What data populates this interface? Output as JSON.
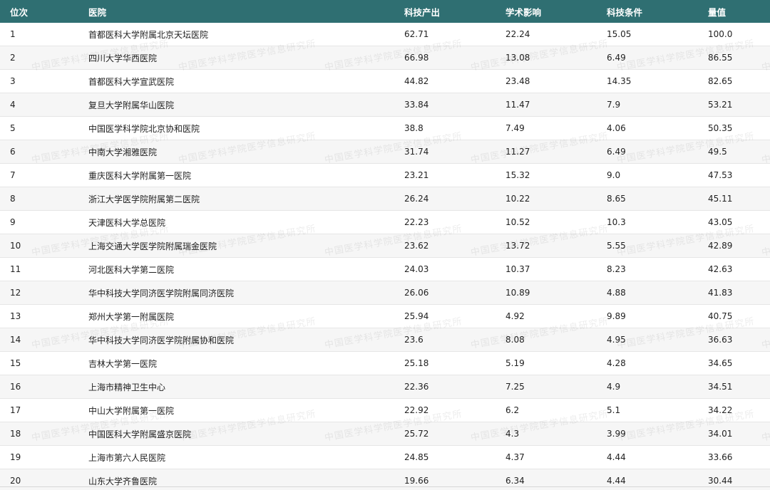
{
  "table": {
    "headers": {
      "rank": "位次",
      "hospital": "医院",
      "output": "科技产出",
      "impact": "学术影响",
      "conditions": "科技条件",
      "score": "量值"
    },
    "rows": [
      {
        "rank": "1",
        "hospital": "首都医科大学附属北京天坛医院",
        "output": "62.71",
        "impact": "22.24",
        "conditions": "15.05",
        "score": "100.0"
      },
      {
        "rank": "2",
        "hospital": "四川大学华西医院",
        "output": "66.98",
        "impact": "13.08",
        "conditions": "6.49",
        "score": "86.55"
      },
      {
        "rank": "3",
        "hospital": "首都医科大学宣武医院",
        "output": "44.82",
        "impact": "23.48",
        "conditions": "14.35",
        "score": "82.65"
      },
      {
        "rank": "4",
        "hospital": "复旦大学附属华山医院",
        "output": "33.84",
        "impact": "11.47",
        "conditions": "7.9",
        "score": "53.21"
      },
      {
        "rank": "5",
        "hospital": "中国医学科学院北京协和医院",
        "output": "38.8",
        "impact": "7.49",
        "conditions": "4.06",
        "score": "50.35"
      },
      {
        "rank": "6",
        "hospital": "中南大学湘雅医院",
        "output": "31.74",
        "impact": "11.27",
        "conditions": "6.49",
        "score": "49.5"
      },
      {
        "rank": "7",
        "hospital": "重庆医科大学附属第一医院",
        "output": "23.21",
        "impact": "15.32",
        "conditions": "9.0",
        "score": "47.53"
      },
      {
        "rank": "8",
        "hospital": "浙江大学医学院附属第二医院",
        "output": "26.24",
        "impact": "10.22",
        "conditions": "8.65",
        "score": "45.11"
      },
      {
        "rank": "9",
        "hospital": "天津医科大学总医院",
        "output": "22.23",
        "impact": "10.52",
        "conditions": "10.3",
        "score": "43.05"
      },
      {
        "rank": "10",
        "hospital": "上海交通大学医学院附属瑞金医院",
        "output": "23.62",
        "impact": "13.72",
        "conditions": "5.55",
        "score": "42.89"
      },
      {
        "rank": "11",
        "hospital": "河北医科大学第二医院",
        "output": "24.03",
        "impact": "10.37",
        "conditions": "8.23",
        "score": "42.63"
      },
      {
        "rank": "12",
        "hospital": "华中科技大学同济医学院附属同济医院",
        "output": "26.06",
        "impact": "10.89",
        "conditions": "4.88",
        "score": "41.83"
      },
      {
        "rank": "13",
        "hospital": "郑州大学第一附属医院",
        "output": "25.94",
        "impact": "4.92",
        "conditions": "9.89",
        "score": "40.75"
      },
      {
        "rank": "14",
        "hospital": "华中科技大学同济医学院附属协和医院",
        "output": "23.6",
        "impact": "8.08",
        "conditions": "4.95",
        "score": "36.63"
      },
      {
        "rank": "15",
        "hospital": "吉林大学第一医院",
        "output": "25.18",
        "impact": "5.19",
        "conditions": "4.28",
        "score": "34.65"
      },
      {
        "rank": "16",
        "hospital": "上海市精神卫生中心",
        "output": "22.36",
        "impact": "7.25",
        "conditions": "4.9",
        "score": "34.51"
      },
      {
        "rank": "17",
        "hospital": "中山大学附属第一医院",
        "output": "22.92",
        "impact": "6.2",
        "conditions": "5.1",
        "score": "34.22"
      },
      {
        "rank": "18",
        "hospital": "中国医科大学附属盛京医院",
        "output": "25.72",
        "impact": "4.3",
        "conditions": "3.99",
        "score": "34.01"
      },
      {
        "rank": "19",
        "hospital": "上海市第六人民医院",
        "output": "24.85",
        "impact": "4.37",
        "conditions": "4.44",
        "score": "33.66"
      },
      {
        "rank": "20",
        "hospital": "山东大学齐鲁医院",
        "output": "19.66",
        "impact": "6.34",
        "conditions": "4.44",
        "score": "30.44"
      }
    ]
  },
  "watermark": {
    "text": "中国医学科学院医学信息研究所"
  },
  "colors": {
    "header_bg": "#2f6f72",
    "header_text": "#ffffff",
    "row_alt_bg": "#f6f6f6",
    "text": "#222222"
  }
}
